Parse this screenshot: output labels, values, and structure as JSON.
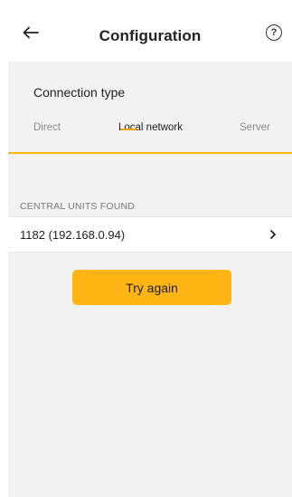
{
  "header": {
    "title": "Configuration",
    "back_icon": "arrow-left-icon",
    "help_icon": "question-circle-icon",
    "help_glyph": "?"
  },
  "connection": {
    "label": "Connection type",
    "tabs": [
      {
        "label": "Direct",
        "active": false
      },
      {
        "label": "Local network",
        "active": true
      },
      {
        "label": "Server",
        "active": false
      }
    ]
  },
  "units": {
    "header": "CENTRAL UNITS FOUND",
    "items": [
      {
        "label": "1182 (192.168.0.94)",
        "icon": "chevron-right-icon"
      }
    ]
  },
  "actions": {
    "try_again_label": "Try again"
  },
  "colors": {
    "accent": "#ffb514",
    "accent_line": "#f5b800",
    "background": "#f2f2f2"
  }
}
